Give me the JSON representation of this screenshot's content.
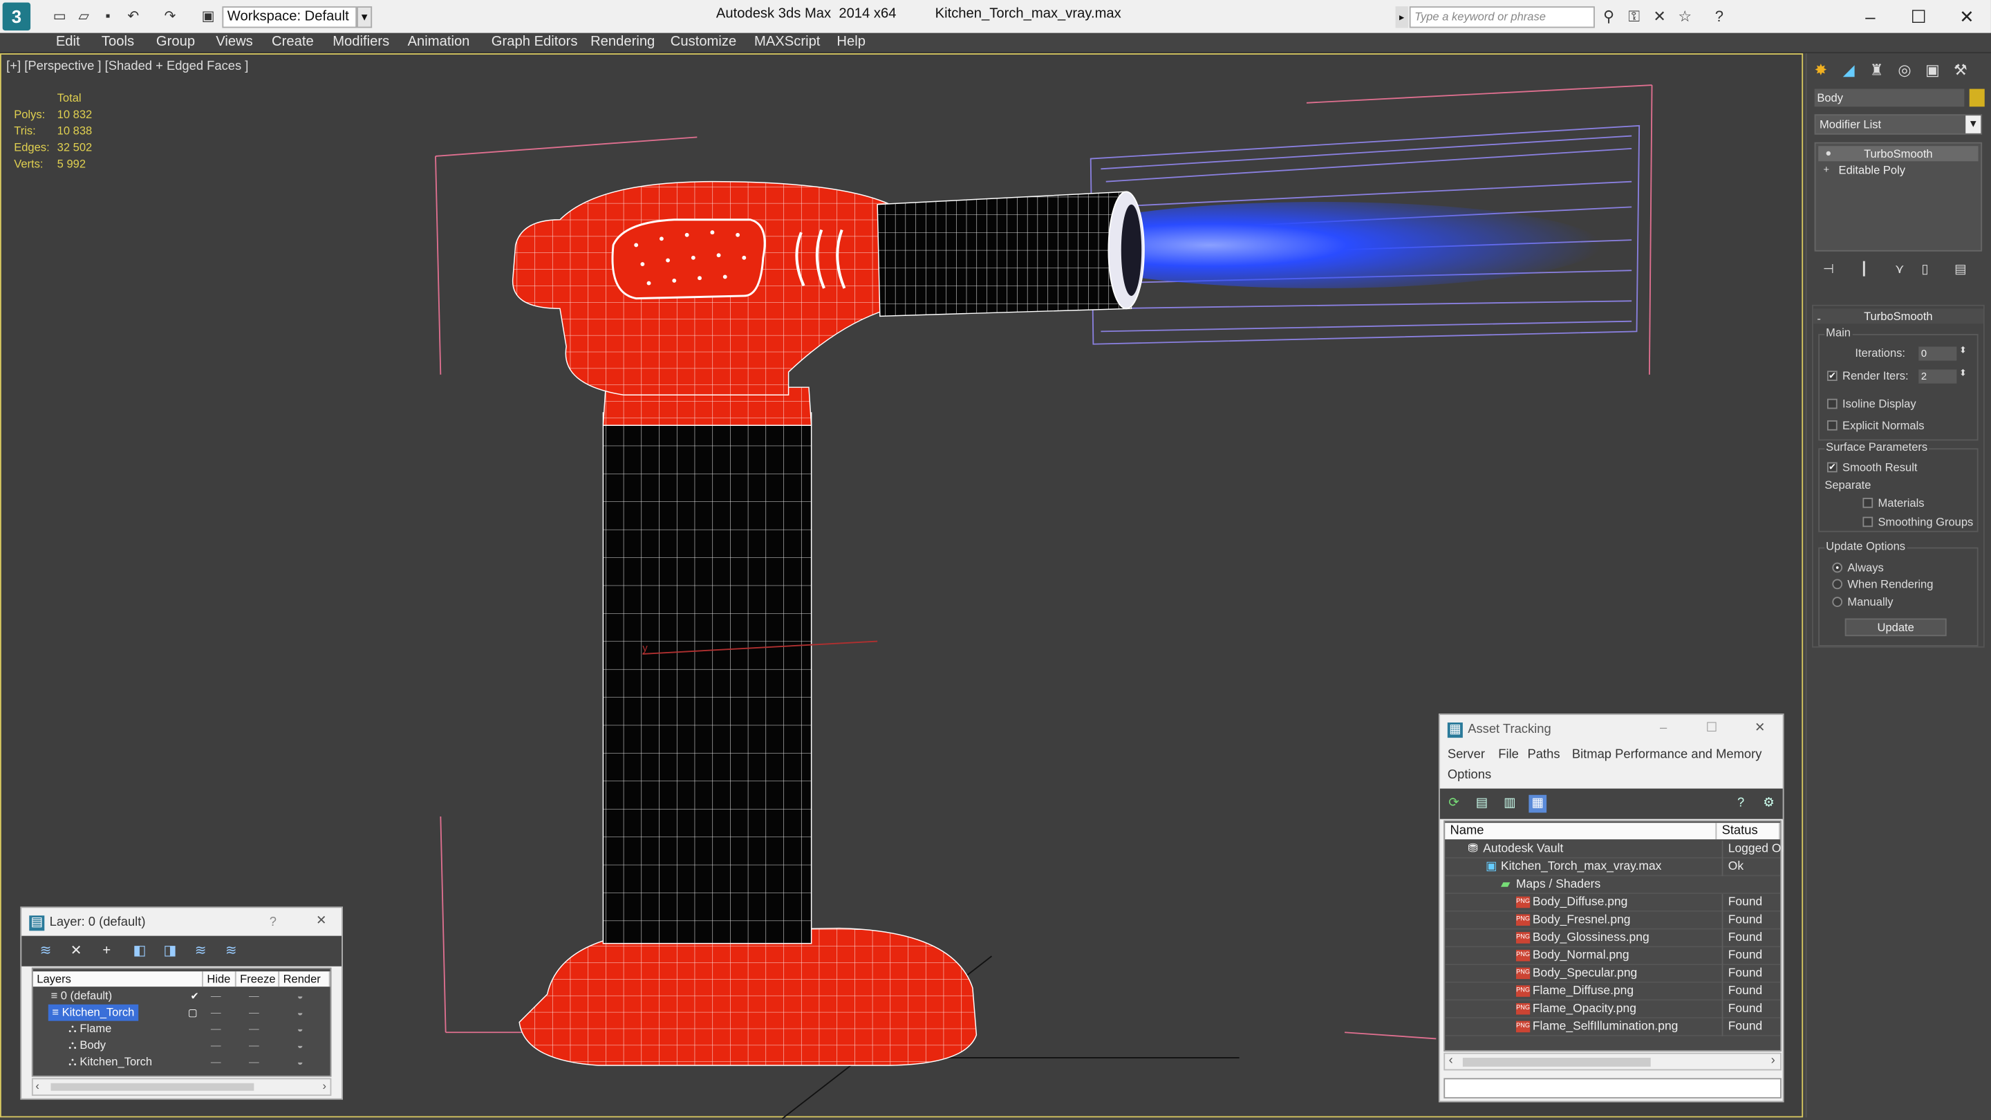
{
  "app": {
    "title": "Autodesk 3ds Max  2014 x64",
    "file": "Kitchen_Torch_max_vray.max",
    "workspace": "Workspace: Default",
    "search_placeholder": "Type a keyword or phrase"
  },
  "menu": [
    "Edit",
    "Tools",
    "Group",
    "Views",
    "Create",
    "Modifiers",
    "Animation",
    "Graph Editors",
    "Rendering",
    "Customize",
    "MAXScript",
    "Help"
  ],
  "viewport": {
    "label": "[+] [Perspective ] [Shaded + Edged Faces ]",
    "stats_header": "Total",
    "stats": [
      {
        "k": "Polys:",
        "v": "10 832"
      },
      {
        "k": "Tris:",
        "v": "10 838"
      },
      {
        "k": "Edges:",
        "v": "32 502"
      },
      {
        "k": "Verts:",
        "v": "5 992"
      }
    ],
    "axis_label": "y"
  },
  "command_panel": {
    "object_name": "Body",
    "object_color": "#d4b020",
    "modifier_list": "Modifier List",
    "stack": [
      "TurboSmooth",
      "Editable Poly"
    ],
    "rollout_title": "TurboSmooth",
    "main_group": "Main",
    "iterations_label": "Iterations:",
    "iterations_value": "0",
    "render_iters_label": "Render Iters:",
    "render_iters_value": "2",
    "render_iters_checked": true,
    "isoline_label": "Isoline Display",
    "explicit_normals_label": "Explicit Normals",
    "surface_group": "Surface Parameters",
    "smooth_result_label": "Smooth Result",
    "separate_label": "Separate",
    "materials_label": "Materials",
    "smoothing_groups_label": "Smoothing Groups",
    "update_group": "Update Options",
    "always_label": "Always",
    "when_rendering_label": "When Rendering",
    "manually_label": "Manually",
    "update_button": "Update"
  },
  "layer_dialog": {
    "title": "Layer: 0 (default)",
    "help": "?",
    "headers": {
      "layers": "Layers",
      "hide": "Hide",
      "freeze": "Freeze",
      "render": "Render"
    },
    "rows": [
      {
        "name": "0 (default)"
      },
      {
        "name": "Kitchen_Torch"
      },
      {
        "name": "Flame"
      },
      {
        "name": "Body"
      },
      {
        "name": "Kitchen_Torch"
      }
    ]
  },
  "asset_dialog": {
    "title": "Asset Tracking",
    "menu": [
      "Server",
      "File",
      "Paths",
      "Bitmap Performance and Memory",
      "Options"
    ],
    "headers": {
      "name": "Name",
      "status": "Status"
    },
    "rows": [
      {
        "name": "Autodesk Vault",
        "status": "Logged Ou"
      },
      {
        "name": "Kitchen_Torch_max_vray.max",
        "status": "Ok"
      },
      {
        "name": "Maps / Shaders",
        "status": ""
      },
      {
        "name": "Body_Diffuse.png",
        "status": "Found"
      },
      {
        "name": "Body_Fresnel.png",
        "status": "Found"
      },
      {
        "name": "Body_Glossiness.png",
        "status": "Found"
      },
      {
        "name": "Body_Normal.png",
        "status": "Found"
      },
      {
        "name": "Body_Specular.png",
        "status": "Found"
      },
      {
        "name": "Flame_Diffuse.png",
        "status": "Found"
      },
      {
        "name": "Flame_Opacity.png",
        "status": "Found"
      },
      {
        "name": "Flame_SelfIllumination.png",
        "status": "Found"
      }
    ],
    "png_badge": "PNG"
  },
  "colors": {
    "body_red": "#e8260e",
    "wire": "#ffffff",
    "flame": "#2a4cff",
    "viewport_border": "#d8c860"
  }
}
